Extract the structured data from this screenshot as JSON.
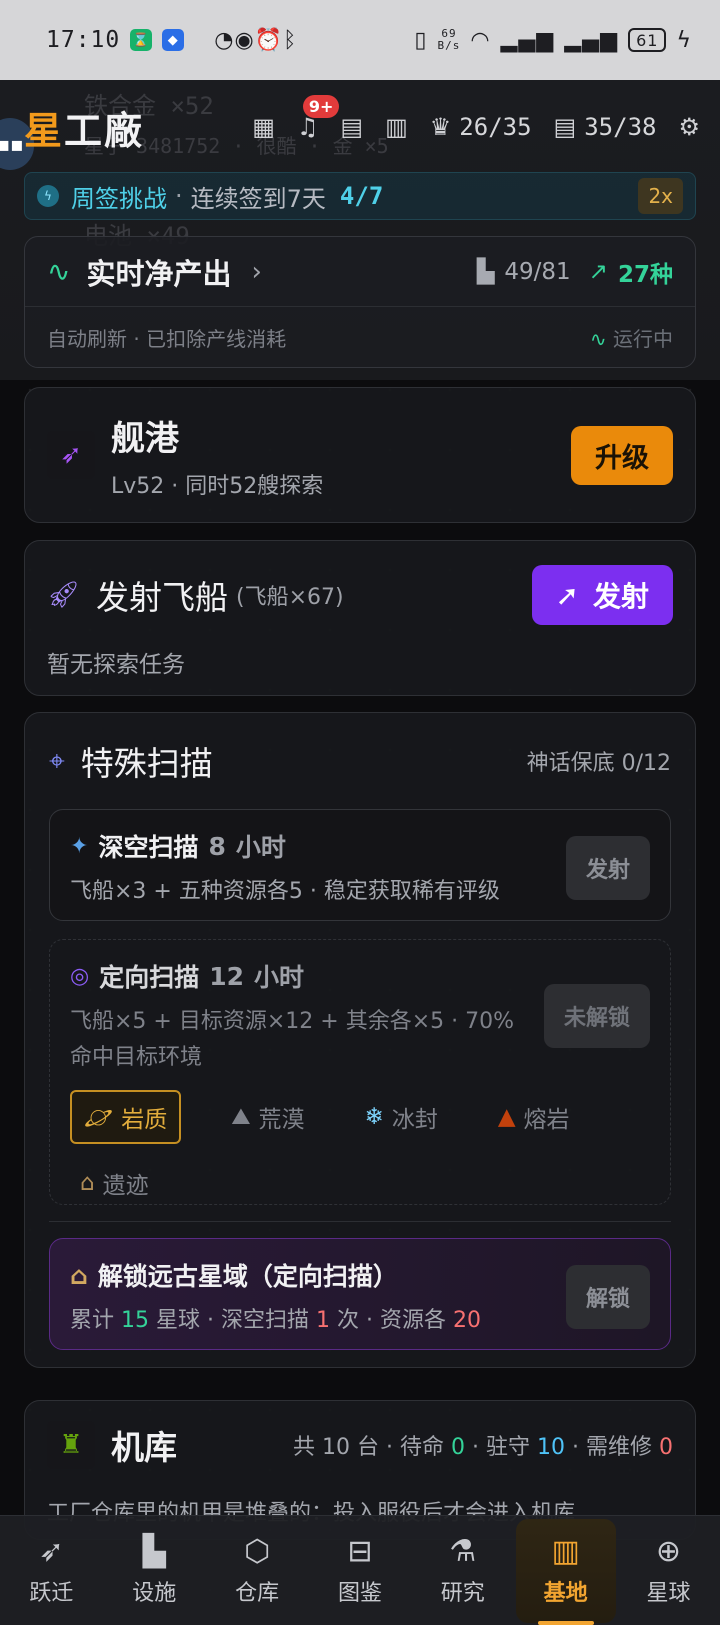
{
  "status_bar": {
    "time": "17:10",
    "net_speed_value": "69",
    "net_speed_unit": "B/s",
    "battery": "61"
  },
  "header": {
    "logo_first": "星",
    "logo_rest": "工廠",
    "notification_badge": "9+",
    "trophies": "26/35",
    "docs": "35/38",
    "ghost_lines": [
      "铁合金 ×52",
      "星子 3481752 · 很酷 · 金 ×5",
      "电池 ×49"
    ]
  },
  "weekly": {
    "title": "周签挑战",
    "sep": "·",
    "desc": "连续签到7天",
    "progress": "4/7",
    "multiplier": "2x"
  },
  "net_output": {
    "title": "实时净产出",
    "ratio": "49/81",
    "kinds": "27种",
    "note": "自动刷新 · 已扣除产线消耗",
    "running": "运行中"
  },
  "shipyard": {
    "title": "舰港",
    "sub": "Lv52 · 同时52艘探索",
    "upgrade": "升级"
  },
  "launch": {
    "title": "发射飞船",
    "count": "(飞船×67)",
    "button": "发射",
    "empty": "暂无探索任务"
  },
  "scan": {
    "title": "特殊扫描",
    "pity": "神话保底 0/12",
    "deep": {
      "name": "深空扫描",
      "hours": "8",
      "hours_unit": "小时",
      "desc": "飞船×3 + 五种资源各5 · 稳定获取稀有评级",
      "button": "发射"
    },
    "directed": {
      "name": "定向扫描",
      "hours": "12",
      "hours_unit": "小时",
      "desc": "飞船×5 + 目标资源×12 + 其余各×5 · 70%命中目标环境",
      "button": "未解锁",
      "envs": [
        {
          "label": "岩质",
          "icon": "planet-icon"
        },
        {
          "label": "荒漠",
          "icon": "desert-icon"
        },
        {
          "label": "冰封",
          "icon": "ice-icon"
        },
        {
          "label": "熔岩",
          "icon": "volcano-icon"
        },
        {
          "label": "遗迹",
          "icon": "ruins-icon"
        }
      ],
      "selected": "岩质"
    },
    "unlock": {
      "title": "解锁远古星域（定向扫描）",
      "pre": "累计",
      "planets": "15",
      "planets_unit": "星球 · 深空扫描",
      "deep_count": "1",
      "deep_unit": "次 · 资源各",
      "res": "20",
      "button": "解锁"
    }
  },
  "hangar": {
    "title": "机库",
    "total_pre": "共",
    "total": "10",
    "total_unit": "台 · 待命",
    "idle": "0",
    "guard_label": "· 驻守",
    "guard": "10",
    "repair_label": "· 需维修",
    "repair": "0",
    "desc": "工厂仓库里的机甲是堆叠的：投入服役后才会进入机库"
  },
  "nav": [
    {
      "label": "跃迁",
      "icon": "rocket-icon"
    },
    {
      "label": "设施",
      "icon": "factory-icon"
    },
    {
      "label": "仓库",
      "icon": "box-icon"
    },
    {
      "label": "图鉴",
      "icon": "book-icon"
    },
    {
      "label": "研究",
      "icon": "flask-icon"
    },
    {
      "label": "基地",
      "icon": "building-icon"
    },
    {
      "label": "星球",
      "icon": "globe-icon"
    }
  ],
  "active_nav": "基地"
}
